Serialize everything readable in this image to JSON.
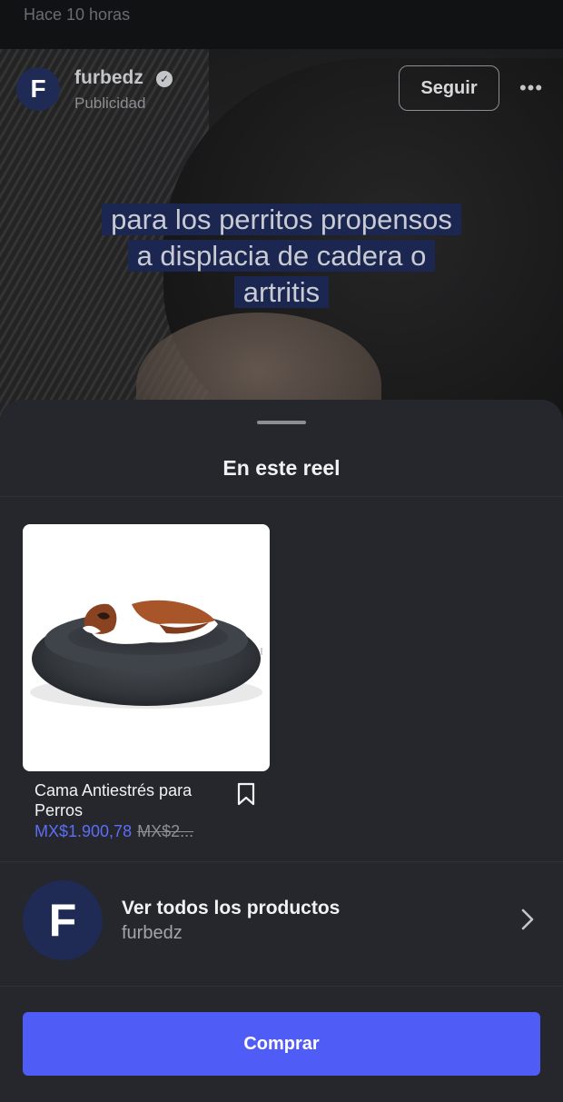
{
  "status": {
    "time_ago": "Hace 10 horas"
  },
  "header": {
    "avatar_letter": "F",
    "account_name": "furbedz",
    "verified_glyph": "✓",
    "sponsored_label": "Publicidad",
    "follow_label": "Seguir",
    "more_icon": "more-horizontal-icon",
    "more_glyph": "•••"
  },
  "video": {
    "caption_lines": [
      "para los perritos propensos",
      "a displacia de cadera o",
      "artritis"
    ]
  },
  "sheet": {
    "title": "En este reel",
    "product": {
      "name": "Cama Antiestrés para Perros",
      "price": "MX$1.900,78",
      "old_price": "MX$2...",
      "save_icon": "bookmark-icon"
    },
    "shop": {
      "avatar_letter": "F",
      "title": "Ver todos los productos",
      "subtitle": "furbedz",
      "chevron_icon": "chevron-right-icon"
    },
    "buy_label": "Comprar"
  },
  "colors": {
    "accent": "#4f5df6",
    "price": "#5b6ef6",
    "sheet_bg": "#25272c",
    "avatar_bg": "#1f2b55"
  }
}
